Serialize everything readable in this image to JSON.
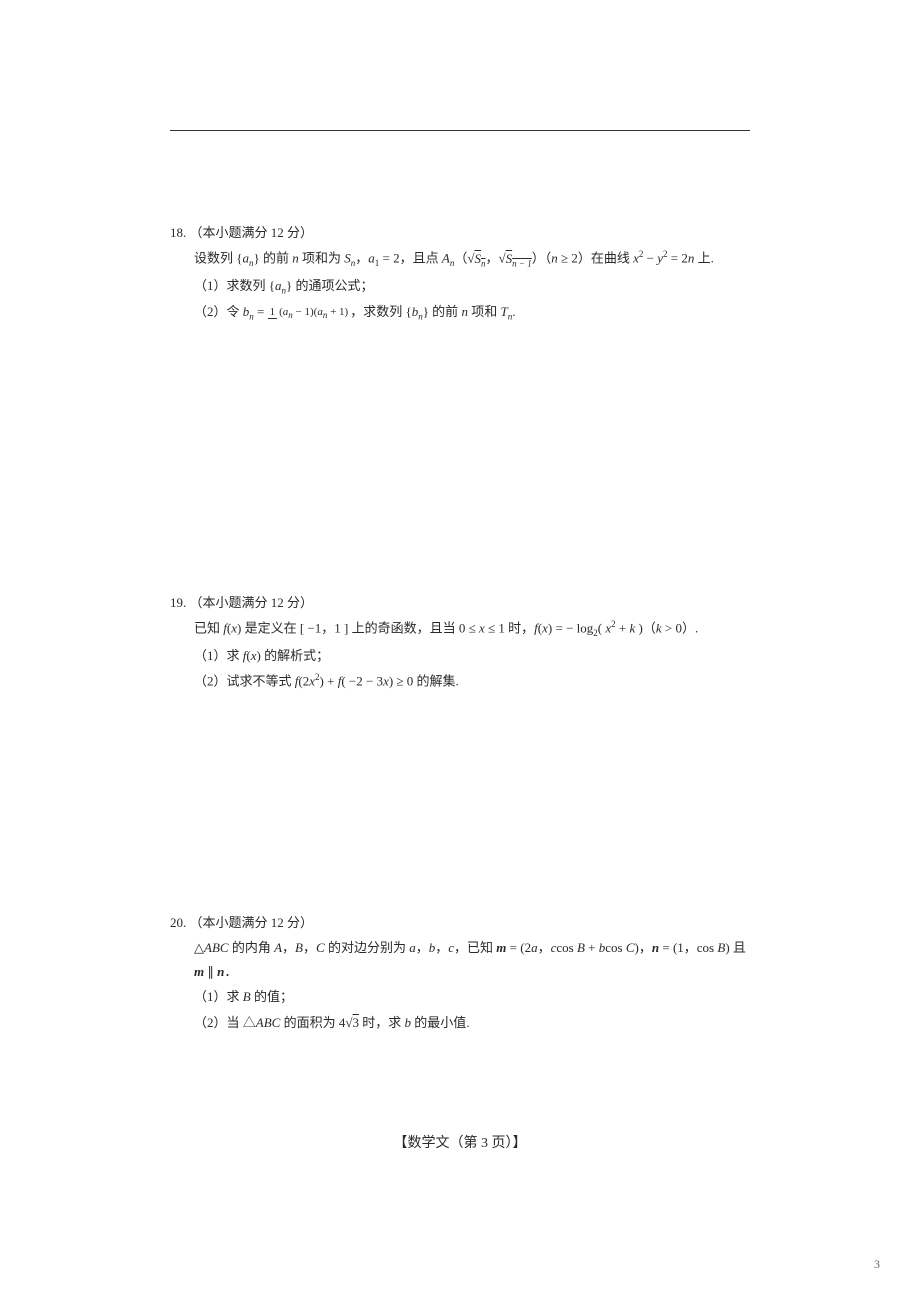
{
  "p18": {
    "num": "18.",
    "head": "（本小题满分 12 分）",
    "l1_a": "设数列 {",
    "l1_b": "} 的前 ",
    "l1_c": " 项和为 ",
    "l1_d": "，",
    "l1_e": " = 2，且点 ",
    "l1_f": "（",
    "l1_g": "，",
    "l1_h": "）（",
    "l1_i": " ≥ 2）在曲线 ",
    "l1_j": " − ",
    "l1_k": " = 2",
    "l1_l": " 上.",
    "q1": "（1）求数列 {",
    "q1b": "} 的通项公式；",
    "q2a": "（2）令 ",
    "q2b": " = ",
    "q2c": "，求数列 {",
    "q2d": "} 的前 ",
    "q2e": " 项和 ",
    "q2f": "."
  },
  "frac18": {
    "top": "1",
    "bot_a": "(",
    "bot_b": " − 1)(",
    "bot_c": " + 1)"
  },
  "p19": {
    "num": "19.",
    "head": "（本小题满分 12 分）",
    "l1a": "已知 ",
    "l1b": "(",
    "l1c": ") 是定义在 [ −1，1 ] 上的奇函数，且当 0 ≤ ",
    "l1d": " ≤ 1 时，",
    "l1e": "(",
    "l1f": ") = − log",
    "l1g": "( ",
    "l1h": " + ",
    "l1i": " )（",
    "l1j": " > 0）.",
    "q1a": "（1）求 ",
    "q1b": "(",
    "q1c": ") 的解析式；",
    "q2a": "（2）试求不等式 ",
    "q2b": "(2",
    "q2c": ") + ",
    "q2d": "( −2 − 3",
    "q2e": ") ≥ 0 的解集."
  },
  "p20": {
    "num": "20.",
    "head": "（本小题满分 12 分）",
    "l1a": "△",
    "l1b": " 的内角 ",
    "l1c": "，",
    "l1d": "，",
    "l1e": " 的对边分别为 ",
    "l1f": "，",
    "l1g": "，",
    "l1h": "，已知 ",
    "l1i": " = (2",
    "l1j": "，",
    "l1k": "cos ",
    "l1l": " + ",
    "l1m": "cos ",
    "l1n": ")，",
    "l1o": " = (1，cos ",
    "l1p": ") 且 ",
    "l1q": " ∥ ",
    "l1r": "．",
    "q1a": "（1）求 ",
    "q1b": " 的值；",
    "q2a": "（2）当 △",
    "q2b": " 的面积为 4",
    "q2c": " 时，求 ",
    "q2d": " 的最小值."
  },
  "sym": {
    "an": "a",
    "n": "n",
    "Sn": "S",
    "a1": "a",
    "one": "1",
    "An": "A",
    "Snm1": "S",
    "nm1": "n − 1",
    "x": "x",
    "y": "y",
    "two": "2",
    "bn": "b",
    "Tn": "T",
    "f": "f",
    "k": "k",
    "ABC": "ABC",
    "A": "A",
    "B": "B",
    "C": "C",
    "a": "a",
    "b": "b",
    "c": "c",
    "m": "m",
    "nvec": "n",
    "sqrt3": "3"
  },
  "footer": "【数学文（第 3 页）】",
  "pageNo": "3"
}
